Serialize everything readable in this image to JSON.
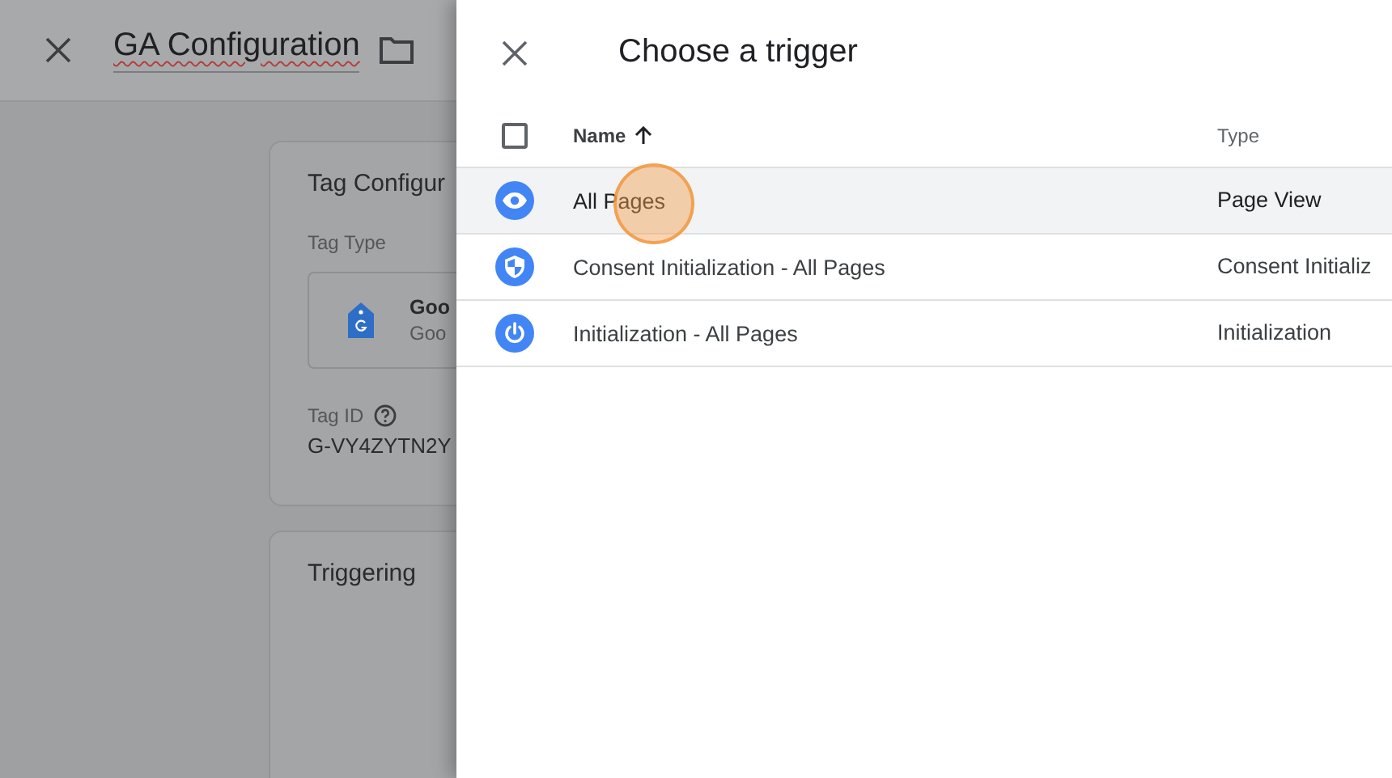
{
  "background_page": {
    "title": "GA Configuration",
    "tag_configuration": {
      "heading": "Tag Configur",
      "tag_type_label": "Tag Type",
      "tag_type_name": "Goo",
      "tag_type_subtitle": "Goo",
      "tag_id_label": "Tag ID",
      "tag_id_value": "G-VY4ZYTN2Y"
    },
    "triggering": {
      "heading": "Triggering"
    }
  },
  "panel": {
    "title": "Choose a trigger",
    "select_all": {
      "checked": false
    },
    "columns": [
      {
        "label": "Name",
        "sorted": true
      },
      {
        "label": "Type"
      }
    ],
    "rows": [
      {
        "kind": "page-view",
        "name": "All Pages",
        "type": "Page View",
        "selected": true
      },
      {
        "kind": "consent",
        "name": "Consent Initialization - All Pages",
        "type": "Consent Initializ",
        "selected": false
      },
      {
        "kind": "initialization",
        "name": "Initialization - All Pages",
        "type": "Initialization",
        "selected": false
      }
    ]
  }
}
